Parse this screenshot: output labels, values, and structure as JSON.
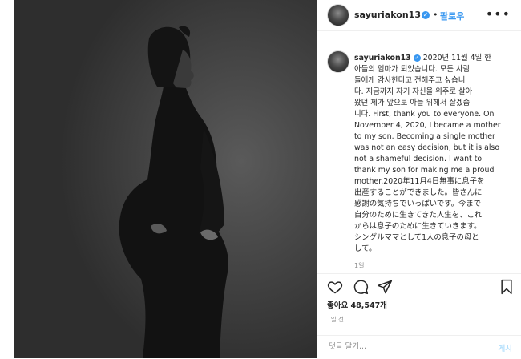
{
  "post": {
    "username": "sayuriakon13",
    "verified_mark": "✓",
    "dot": "•",
    "follow_label": "팔로우",
    "more_icon": "more-horizontal-icon",
    "caption_lines": [
      "2020년 11월 4일 한",
      "아들의 엄마가 되었습니다. 모든 사람",
      "들에게 감사한다고 전해주고 싶습니",
      "다. 지금까지 자기 자신을 위주로 살아",
      "왔던 제가 앞으로 아들 위해서 살겠습",
      "니다. First, thank you to everyone. On",
      "November 4, 2020, I became a mother",
      "to my son. Becoming a single mother",
      "was not an easy decision, but it is also",
      "not a shameful decision. I want to",
      "thank my son for making me a proud",
      "mother.2020年11月4日無事に息子を",
      "出産することができました。皆さんに",
      "感謝の気持ちでいっぱいです。今まで",
      "自分のために生きてきた人生を、これ",
      "からは息子のために生きていきます。",
      "シングルママとして1人の息子の母と",
      "して。"
    ],
    "caption_time": "1일",
    "likes": "좋아요 48,547개",
    "ago": "1일 전",
    "comment_placeholder": "댓글 달기...",
    "post_button": "게시"
  }
}
